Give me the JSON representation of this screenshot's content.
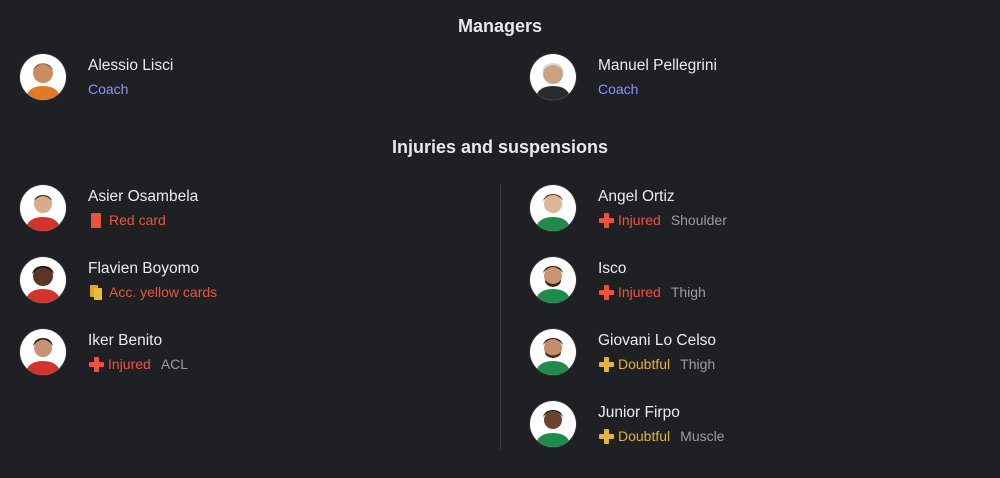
{
  "managers": {
    "title": "Managers",
    "items": [
      {
        "name": "Alessio Lisci",
        "role": "Coach"
      },
      {
        "name": "Manuel Pellegrini",
        "role": "Coach"
      }
    ]
  },
  "injuries": {
    "title": "Injuries and suspensions",
    "left": [
      {
        "name": "Asier Osambela",
        "status": "Red card",
        "detail": "",
        "icon": "red-card-icon"
      },
      {
        "name": "Flavien Boyomo",
        "status": "Acc. yellow cards",
        "detail": "",
        "icon": "yellow-cards-icon"
      },
      {
        "name": "Iker Benito",
        "status": "Injured",
        "detail": "ACL",
        "icon": "injury-cross-icon"
      }
    ],
    "right": [
      {
        "name": "Angel Ortiz",
        "status": "Injured",
        "detail": "Shoulder",
        "icon": "injury-cross-icon"
      },
      {
        "name": "Isco",
        "status": "Injured",
        "detail": "Thigh",
        "icon": "injury-cross-icon"
      },
      {
        "name": "Giovani Lo Celso",
        "status": "Doubtful",
        "detail": "Thigh",
        "icon": "doubtful-cross-icon"
      },
      {
        "name": "Junior Firpo",
        "status": "Doubtful",
        "detail": "Muscle",
        "icon": "doubtful-cross-icon"
      }
    ]
  },
  "colors": {
    "background": "#1e2024",
    "coach": "#8b93ff",
    "injured": "#e8553f",
    "doubtful": "#e3b341",
    "detail": "#9a9ca1"
  }
}
